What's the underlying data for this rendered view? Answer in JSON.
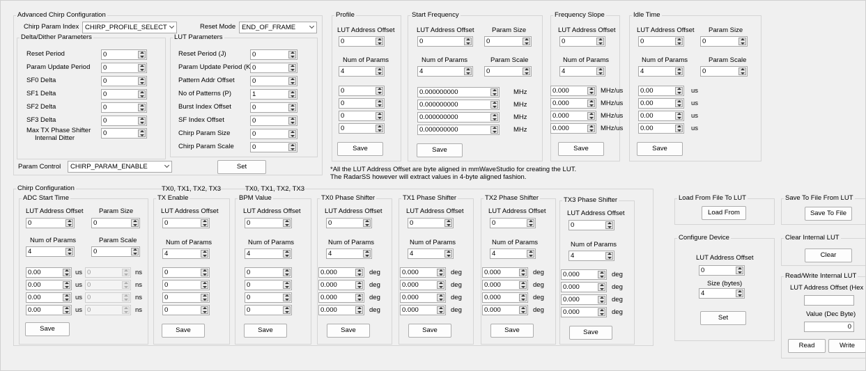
{
  "advanced": {
    "title": "Advanced Chirp Configuration",
    "param_index_label": "Chirp Param Index",
    "param_index_value": "CHIRP_PROFILE_SELECT",
    "reset_mode_label": "Reset Mode",
    "reset_mode_value": "END_OF_FRAME",
    "delta_title": "Delta/Dither Parameters",
    "delta": [
      {
        "label": "Reset Period",
        "value": "0"
      },
      {
        "label": "Param Update Period",
        "value": "0"
      },
      {
        "label": "SF0 Delta",
        "value": "0"
      },
      {
        "label": "SF1 Delta",
        "value": "0"
      },
      {
        "label": "SF2 Delta",
        "value": "0"
      },
      {
        "label": "SF3 Delta",
        "value": "0"
      }
    ],
    "max_tx_label1": "Max TX Phase Shifter",
    "max_tx_label2": "Internal Ditter",
    "max_tx_value": "0",
    "lut_title": "LUT Parameters",
    "lut": [
      {
        "label": "Reset Period (J)",
        "value": "0"
      },
      {
        "label": "Param Update Period (K)",
        "value": "0"
      },
      {
        "label": "Pattern Addr Offset",
        "value": "0"
      },
      {
        "label": "No of Patterns (P)",
        "value": "1"
      },
      {
        "label": "Burst Index Offset",
        "value": "0"
      },
      {
        "label": "SF Index Offset",
        "value": "0"
      },
      {
        "label": "Chirp Param Size",
        "value": "0"
      },
      {
        "label": "Chirp Param Scale",
        "value": "0"
      }
    ],
    "param_control_label": "Param Control",
    "param_control_value": "CHIRP_PARAM_ENABLE",
    "set_label": "Set"
  },
  "common": {
    "lut_offset": "LUT Address Offset",
    "num_params": "Num of Params",
    "param_size": "Param Size",
    "param_scale": "Param Scale",
    "save": "Save"
  },
  "profile": {
    "title": "Profile",
    "offset": "0",
    "num": "4",
    "values": [
      "0",
      "0",
      "0",
      "0"
    ]
  },
  "start_freq": {
    "title": "Start Frequency",
    "offset": "0",
    "size": "0",
    "num": "4",
    "scale": "0",
    "values": [
      "0.000000000",
      "0.000000000",
      "0.000000000",
      "0.000000000"
    ],
    "unit": "MHz"
  },
  "freq_slope": {
    "title": "Frequency Slope",
    "offset": "0",
    "num": "4",
    "values": [
      "0.000",
      "0.000",
      "0.000",
      "0.000"
    ],
    "unit": "MHz/us"
  },
  "idle_time": {
    "title": "Idle Time",
    "offset": "0",
    "size": "0",
    "num": "4",
    "scale": "0",
    "values": [
      "0.00",
      "0.00",
      "0.00",
      "0.00"
    ],
    "unit": "us"
  },
  "note": {
    "line1": "*All the LUT Address Offset are byte aligned in mmWaveStudio for creating the LUT.",
    "line2": "The RadarSS however will extract values in 4-byte aligned fashion."
  },
  "chirp": {
    "title": "Chirp Configuration",
    "adc": {
      "title": "ADC Start Time",
      "offset": "0",
      "size": "0",
      "num": "4",
      "scale": "0",
      "values": [
        "0.00",
        "0.00",
        "0.00",
        "0.00"
      ],
      "unit": "us",
      "sub_values": [
        "0",
        "0",
        "0",
        "0"
      ],
      "sub_unit": "ns"
    },
    "tx_header": "TX0, TX1, TX2, TX3",
    "tx_enable": {
      "title": "TX Enable",
      "offset": "0",
      "num": "4",
      "values": [
        "0",
        "0",
        "0",
        "0"
      ]
    },
    "bpm": {
      "title": "BPM Value",
      "offset": "0",
      "num": "4",
      "values": [
        "0",
        "0",
        "0",
        "0"
      ]
    },
    "phase_unit": "deg",
    "phase": [
      {
        "title": "TX0 Phase Shifter",
        "offset": "0",
        "num": "4",
        "values": [
          "0.000",
          "0.000",
          "0.000",
          "0.000"
        ]
      },
      {
        "title": "TX1 Phase Shifter",
        "offset": "0",
        "num": "4",
        "values": [
          "0.000",
          "0.000",
          "0.000",
          "0.000"
        ]
      },
      {
        "title": "TX2 Phase Shifter",
        "offset": "0",
        "num": "4",
        "values": [
          "0.000",
          "0.000",
          "0.000",
          "0.000"
        ]
      },
      {
        "title": "TX3 Phase Shifter",
        "offset": "0",
        "num": "4",
        "values": [
          "0.000",
          "0.000",
          "0.000",
          "0.000"
        ]
      }
    ]
  },
  "load": {
    "title": "Load From File To LUT",
    "button": "Load From"
  },
  "configure": {
    "title": "Configure Device",
    "offset_label": "LUT Address Offset",
    "offset": "0",
    "size_label": "Size (bytes)",
    "size": "4",
    "button": "Set"
  },
  "save_file": {
    "title": "Save To File From LUT",
    "button": "Save To File"
  },
  "clear": {
    "title": "Clear Internal LUT",
    "button": "Clear"
  },
  "rw": {
    "title": "Read/Write Internal LUT",
    "offset_label": "LUT Address Offset (Hex Byte)",
    "offset_value": "",
    "value_label": "Value (Dec Byte)",
    "value": "0",
    "read": "Read",
    "write": "Write"
  }
}
